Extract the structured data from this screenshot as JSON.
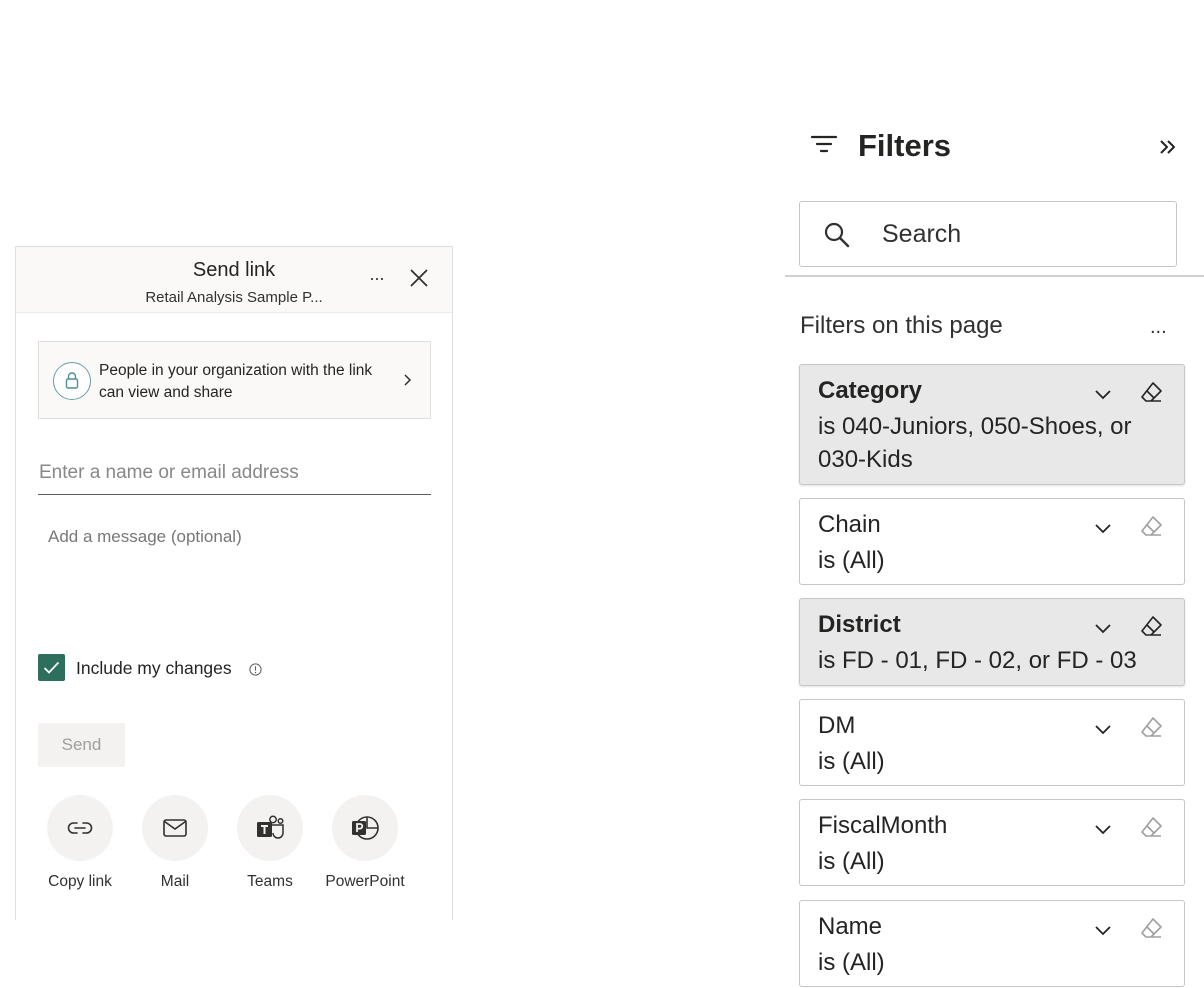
{
  "send_link": {
    "title": "Send link",
    "subtitle": "Retail Analysis Sample P...",
    "more_label": "...",
    "permission": {
      "text": "People in your organization with the link can view and share"
    },
    "recipient": {
      "placeholder": "Enter a name or email address",
      "value": ""
    },
    "message": {
      "placeholder": "Add a message (optional)",
      "value": ""
    },
    "include_changes": {
      "label": "Include my changes",
      "checked": true
    },
    "send_label": "Send",
    "share_options": [
      {
        "label": "Copy link",
        "icon": "link-icon"
      },
      {
        "label": "Mail",
        "icon": "mail-icon"
      },
      {
        "label": "Teams",
        "icon": "teams-icon"
      },
      {
        "label": "PowerPoint",
        "icon": "powerpoint-icon"
      }
    ]
  },
  "filters": {
    "title": "Filters",
    "search": {
      "placeholder": "Search",
      "value": ""
    },
    "section_title": "Filters on this page",
    "section_more": "...",
    "cards": [
      {
        "name": "Category",
        "value": "is 040-Juniors, 050-Shoes, or 030-Kids",
        "active": true
      },
      {
        "name": "Chain",
        "value": "is (All)",
        "active": false
      },
      {
        "name": "District",
        "value": "is FD - 01, FD - 02, or FD - 03",
        "active": true
      },
      {
        "name": "DM",
        "value": "is (All)",
        "active": false
      },
      {
        "name": "FiscalMonth",
        "value": "is (All)",
        "active": false
      },
      {
        "name": "Name",
        "value": "is (All)",
        "active": false
      }
    ]
  },
  "colors": {
    "accent_green": "#2e6e5c",
    "active_card_bg": "#e8e8e8",
    "disabled_text": "#a19f9d"
  }
}
